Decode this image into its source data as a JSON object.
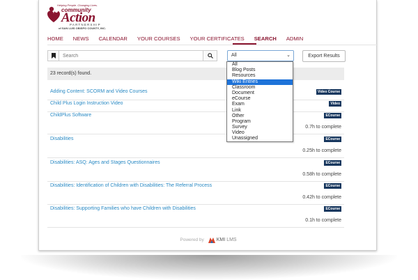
{
  "brand": {
    "tagline": "Helping People. Changing Lives.",
    "community": "community",
    "action": "Action",
    "partnership": "PARTNERSHIP",
    "county": "of SAN LUIS OBISPO COUNTY, INC.",
    "color": "#8a1530"
  },
  "nav": {
    "items": [
      "HOME",
      "NEWS",
      "CALENDAR",
      "YOUR COURSES",
      "YOUR CERTIFICATES",
      "SEARCH",
      "ADMIN"
    ],
    "active": "SEARCH"
  },
  "search": {
    "placeholder": "Search",
    "selected_type": "All",
    "export_label": "Export Results"
  },
  "dropdown": {
    "options": [
      "All",
      "Blog Posts",
      "Resources",
      "Wiki Entries",
      "Classroom",
      "Document",
      "eCourse",
      "Exam",
      "Link",
      "Other",
      "Program",
      "Survey",
      "Video",
      "Unassigned"
    ],
    "highlighted": "Wiki Entries"
  },
  "records": {
    "summary": "23 record(s) found."
  },
  "results": [
    {
      "title": "Adding Content: SCORM and Video Courses",
      "badge": "Video Course",
      "time": ""
    },
    {
      "title": "Child Plus Login Instruction Video",
      "badge": "Video",
      "time": ""
    },
    {
      "title": "ChildPlus Software",
      "badge": "ECourse",
      "time": "0.7h to complete"
    },
    {
      "title": "Disabilities",
      "badge": "ECourse",
      "time": "0.25h to complete"
    },
    {
      "title": "Disabilities: ASQ: Ages and Stages Questionnaires",
      "badge": "ECourse",
      "time": "0.58h to complete"
    },
    {
      "title": "Disabilities: Identification of Children with Disabilities: The Referral Process",
      "badge": "ECourse",
      "time": "0.42h to complete"
    },
    {
      "title": "Disabilities: Supporting Families who have Children with Disabilities",
      "badge": "ECourse",
      "time": "0.1h to complete"
    }
  ],
  "footer": {
    "powered_by": "Powered by",
    "kmi": "KMI",
    "lms": "LMS"
  },
  "colors": {
    "link": "#2a8ac4",
    "badge": "#17375e",
    "highlight": "#1e73d9"
  }
}
